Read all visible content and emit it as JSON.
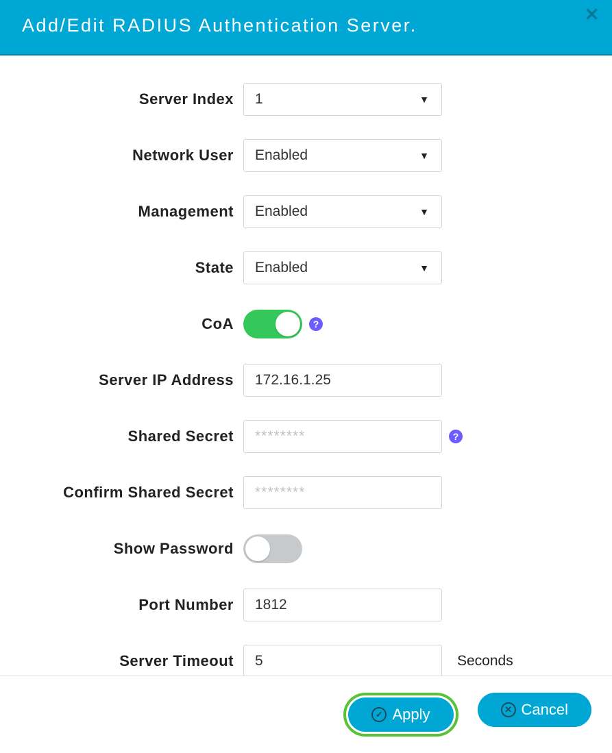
{
  "dialog": {
    "title": "Add/Edit RADIUS Authentication Server."
  },
  "fields": {
    "server_index": {
      "label": "Server Index",
      "value": "1"
    },
    "network_user": {
      "label": "Network User",
      "value": "Enabled"
    },
    "management": {
      "label": "Management",
      "value": "Enabled"
    },
    "state": {
      "label": "State",
      "value": "Enabled"
    },
    "coa": {
      "label": "CoA"
    },
    "server_ip": {
      "label": "Server IP Address",
      "value": "172.16.1.25"
    },
    "shared_secret": {
      "label": "Shared Secret",
      "placeholder": "********"
    },
    "confirm_secret": {
      "label": "Confirm Shared Secret",
      "placeholder": "********"
    },
    "show_password": {
      "label": "Show Password"
    },
    "port_number": {
      "label": "Port Number",
      "value": "1812"
    },
    "server_timeout": {
      "label": "Server Timeout",
      "value": "5",
      "unit": "Seconds"
    }
  },
  "buttons": {
    "apply": "Apply",
    "cancel": "Cancel"
  }
}
